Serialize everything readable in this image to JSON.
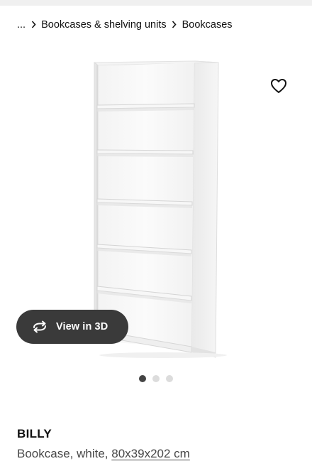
{
  "breadcrumb": {
    "ellipsis": "...",
    "items": [
      "Bookcases & shelving units",
      "Bookcases"
    ]
  },
  "icons": {
    "favorite": "heart-outline-icon",
    "view_3d": "rotate-3d-icon",
    "separator": "chevron-right-icon"
  },
  "gallery": {
    "view3d_label": "View in 3D",
    "slide_count": 3,
    "active_slide": 1
  },
  "product": {
    "name": "BILLY",
    "description": "Bookcase, white, ",
    "measurement": "80x39x202 cm"
  },
  "colors": {
    "view3d_bg": "#3a3a3a",
    "dot_active": "#444444",
    "dot_inactive": "#dcdcdc"
  }
}
